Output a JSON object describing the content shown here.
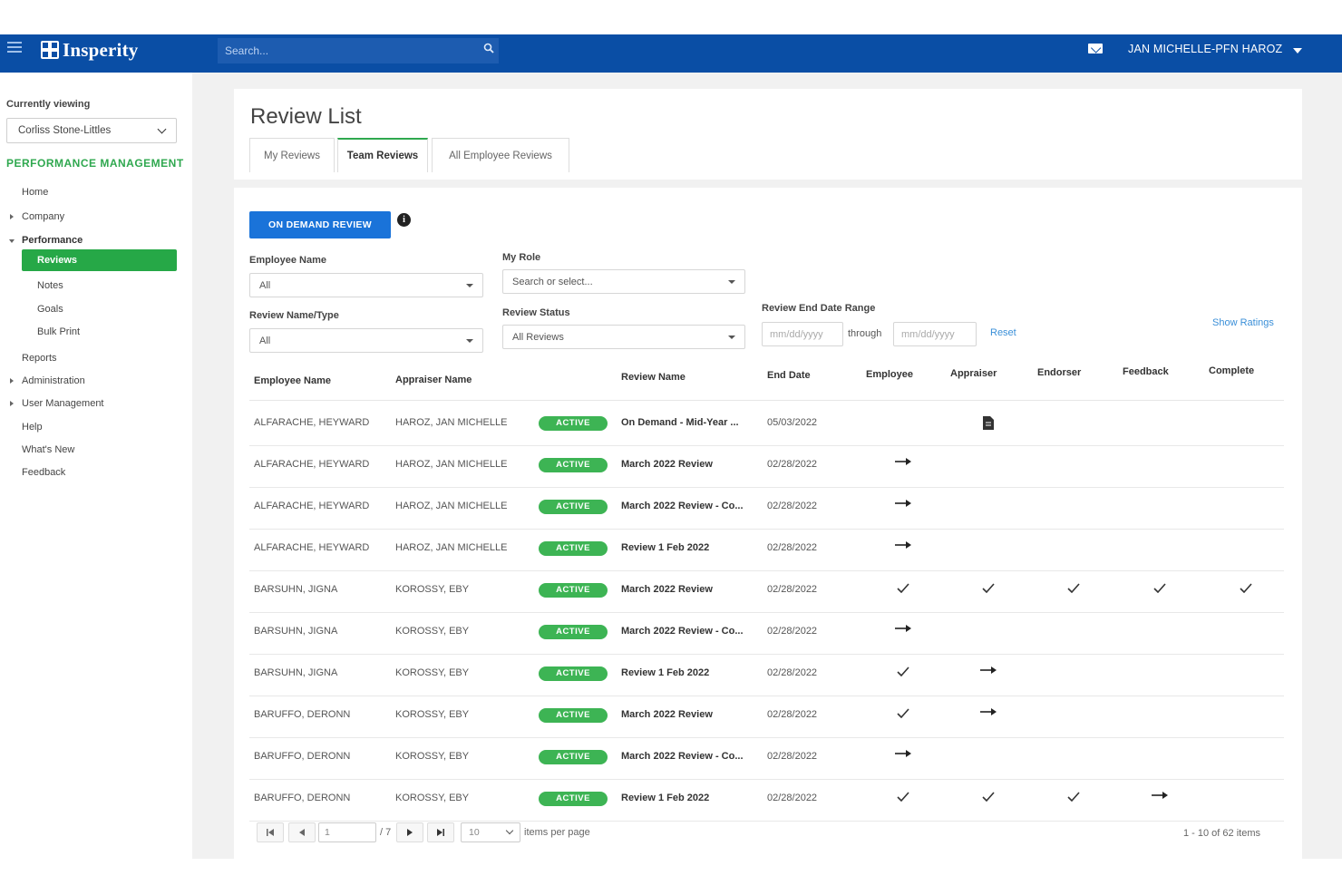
{
  "header": {
    "logo_text": "Insperity",
    "search_placeholder": "Search...",
    "user_name": "JAN MICHELLE-PFN HAROZ"
  },
  "sidebar": {
    "currently_viewing_label": "Currently viewing",
    "currently_viewing_value": "Corliss Stone-Littles",
    "section_title": "PERFORMANCE MANAGEMENT",
    "items": [
      {
        "label": "Home"
      },
      {
        "label": "Company"
      },
      {
        "label": "Performance"
      },
      {
        "label": "Reviews"
      },
      {
        "label": "Notes"
      },
      {
        "label": "Goals"
      },
      {
        "label": "Bulk Print"
      },
      {
        "label": "Reports"
      },
      {
        "label": "Administration"
      },
      {
        "label": "User Management"
      },
      {
        "label": "Help"
      },
      {
        "label": "What's New"
      },
      {
        "label": "Feedback"
      }
    ]
  },
  "page": {
    "title": "Review List",
    "tabs": [
      {
        "label": "My Reviews"
      },
      {
        "label": "Team Reviews"
      },
      {
        "label": "All Employee Reviews"
      }
    ]
  },
  "filters": {
    "on_demand_label": "ON DEMAND REVIEW",
    "info_glyph": "i",
    "employee_name_label": "Employee Name",
    "employee_name_value": "All",
    "my_role_label": "My Role",
    "my_role_placeholder": "Search or select...",
    "review_name_type_label": "Review Name/Type",
    "review_name_type_value": "All",
    "review_status_label": "Review Status",
    "review_status_value": "All Reviews",
    "date_range_label": "Review End Date Range",
    "date_from_placeholder": "mm/dd/yyyy",
    "through_label": "through",
    "date_to_placeholder": "mm/dd/yyyy",
    "reset_label": "Reset",
    "show_ratings_label": "Show Ratings"
  },
  "table": {
    "columns": [
      "Employee Name",
      "Appraiser Name",
      "Review Name",
      "End Date",
      "Employee",
      "Appraiser",
      "Endorser",
      "Feedback",
      "Complete"
    ],
    "rows": [
      {
        "employee": "ALFARACHE, HEYWARD",
        "appraiser": "HAROZ, JAN MICHELLE",
        "status": "ACTIVE",
        "review": "On Demand - Mid-Year ...",
        "end_date": "05/03/2022",
        "steps": [
          "",
          "document",
          "",
          "",
          ""
        ]
      },
      {
        "employee": "ALFARACHE, HEYWARD",
        "appraiser": "HAROZ, JAN MICHELLE",
        "status": "ACTIVE",
        "review": "March 2022 Review",
        "end_date": "02/28/2022",
        "steps": [
          "arrow",
          "",
          "",
          "",
          ""
        ]
      },
      {
        "employee": "ALFARACHE, HEYWARD",
        "appraiser": "HAROZ, JAN MICHELLE",
        "status": "ACTIVE",
        "review": "March 2022 Review - Co...",
        "end_date": "02/28/2022",
        "steps": [
          "arrow",
          "",
          "",
          "",
          ""
        ]
      },
      {
        "employee": "ALFARACHE, HEYWARD",
        "appraiser": "HAROZ, JAN MICHELLE",
        "status": "ACTIVE",
        "review": "Review 1 Feb 2022",
        "end_date": "02/28/2022",
        "steps": [
          "arrow",
          "",
          "",
          "",
          ""
        ]
      },
      {
        "employee": "BARSUHN, JIGNA",
        "appraiser": "KOROSSY, EBY",
        "status": "ACTIVE",
        "review": "March 2022 Review",
        "end_date": "02/28/2022",
        "steps": [
          "check",
          "check",
          "check",
          "check",
          "check"
        ]
      },
      {
        "employee": "BARSUHN, JIGNA",
        "appraiser": "KOROSSY, EBY",
        "status": "ACTIVE",
        "review": "March 2022 Review - Co...",
        "end_date": "02/28/2022",
        "steps": [
          "arrow",
          "",
          "",
          "",
          ""
        ]
      },
      {
        "employee": "BARSUHN, JIGNA",
        "appraiser": "KOROSSY, EBY",
        "status": "ACTIVE",
        "review": "Review 1 Feb 2022",
        "end_date": "02/28/2022",
        "steps": [
          "check",
          "arrow",
          "",
          "",
          ""
        ]
      },
      {
        "employee": "BARUFFO, DERONN",
        "appraiser": "KOROSSY, EBY",
        "status": "ACTIVE",
        "review": "March 2022 Review",
        "end_date": "02/28/2022",
        "steps": [
          "check",
          "arrow",
          "",
          "",
          ""
        ]
      },
      {
        "employee": "BARUFFO, DERONN",
        "appraiser": "KOROSSY, EBY",
        "status": "ACTIVE",
        "review": "March 2022 Review - Co...",
        "end_date": "02/28/2022",
        "steps": [
          "arrow",
          "",
          "",
          "",
          ""
        ]
      },
      {
        "employee": "BARUFFO, DERONN",
        "appraiser": "KOROSSY, EBY",
        "status": "ACTIVE",
        "review": "Review 1 Feb 2022",
        "end_date": "02/28/2022",
        "steps": [
          "check",
          "check",
          "check",
          "arrow",
          ""
        ]
      }
    ]
  },
  "pagination": {
    "page_value": "1",
    "page_total": "/ 7",
    "per_page_value": "10",
    "per_page_label": "items per page",
    "summary": "1 - 10 of 62 items"
  },
  "colors": {
    "header_blue": "#0a4ea5",
    "brand_green": "#2fa84f",
    "active_badge": "#3db454",
    "primary_button": "#1a73d9"
  }
}
